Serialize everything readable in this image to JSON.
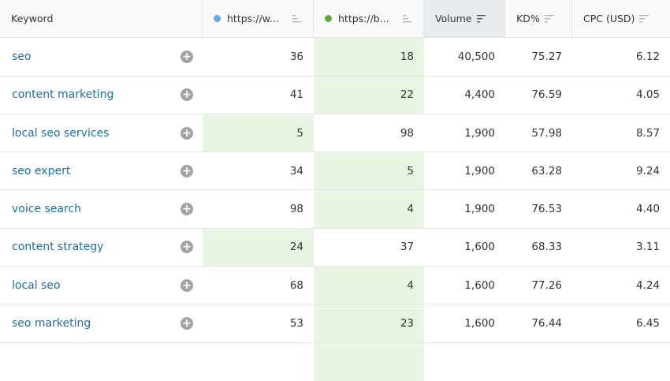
{
  "header": {
    "keyword": "Keyword",
    "site_a": "https://w...",
    "site_b": "https://b...",
    "volume": "Volume",
    "kd": "KD%",
    "cpc": "CPC (USD)"
  },
  "colors": {
    "site_a_dot": "#64a8f0",
    "site_b_dot": "#5cab3a",
    "highlight": "#e8f5e2",
    "link": "#1c6ea4"
  },
  "rows": [
    {
      "keyword": "seo",
      "a": "36",
      "b": "18",
      "volume": "40,500",
      "kd": "75.27",
      "cpc": "6.12",
      "best": "b"
    },
    {
      "keyword": "content marketing",
      "a": "41",
      "b": "22",
      "volume": "4,400",
      "kd": "76.59",
      "cpc": "4.05",
      "best": "b"
    },
    {
      "keyword": "local seo services",
      "a": "5",
      "b": "98",
      "volume": "1,900",
      "kd": "57.98",
      "cpc": "8.57",
      "best": "a"
    },
    {
      "keyword": "seo expert",
      "a": "34",
      "b": "5",
      "volume": "1,900",
      "kd": "63.28",
      "cpc": "9.24",
      "best": "b"
    },
    {
      "keyword": "voice search",
      "a": "98",
      "b": "4",
      "volume": "1,900",
      "kd": "76.53",
      "cpc": "4.40",
      "best": "b"
    },
    {
      "keyword": "content strategy",
      "a": "24",
      "b": "37",
      "volume": "1,600",
      "kd": "68.33",
      "cpc": "3.11",
      "best": "a"
    },
    {
      "keyword": "local seo",
      "a": "68",
      "b": "4",
      "volume": "1,600",
      "kd": "77.26",
      "cpc": "4.24",
      "best": "b"
    },
    {
      "keyword": "seo marketing",
      "a": "53",
      "b": "23",
      "volume": "1,600",
      "kd": "76.44",
      "cpc": "6.45",
      "best": "b"
    }
  ],
  "add_icon_symbol": "+"
}
